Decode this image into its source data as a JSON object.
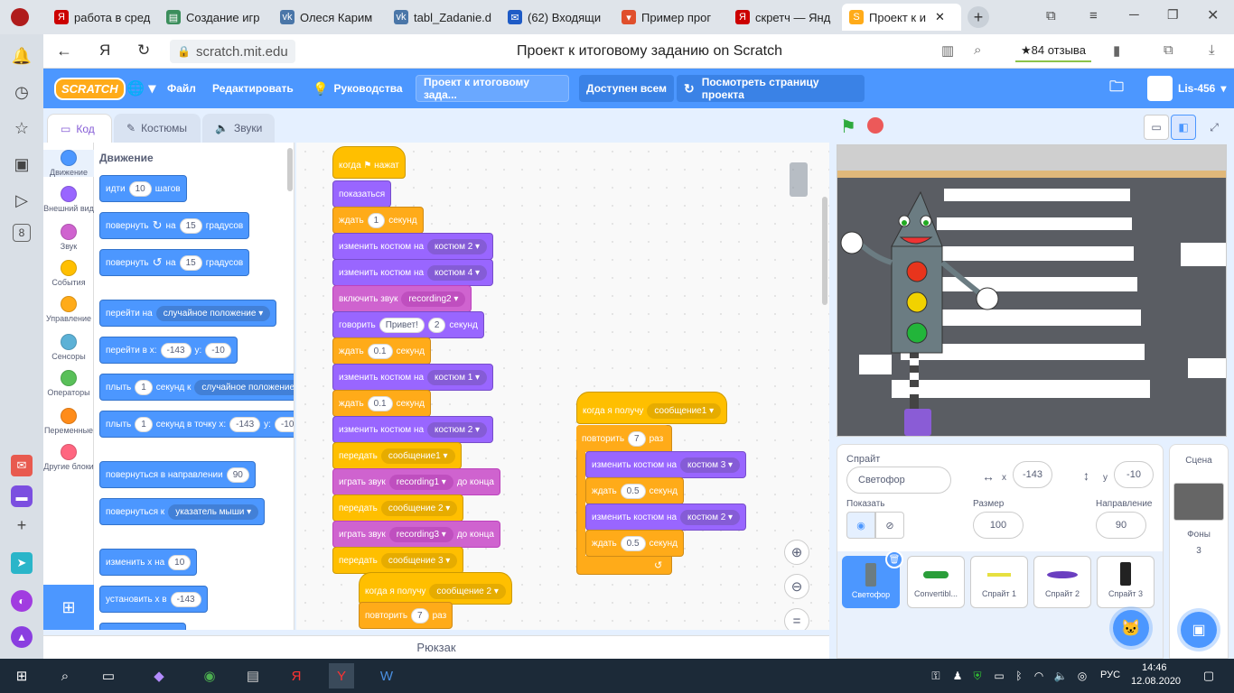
{
  "browser": {
    "tabs": [
      {
        "label": "работа в сред",
        "color": "#cc0000",
        "icon": "Я"
      },
      {
        "label": "Создание игр",
        "color": "#3b8e5c",
        "icon": "▤"
      },
      {
        "label": "Олеся Карим",
        "color": "#4a76a8",
        "icon": "vk"
      },
      {
        "label": "tabl_Zadanie.d",
        "color": "#4a76a8",
        "icon": "vk"
      },
      {
        "label": "(62) Входящи",
        "color": "#1e5bc6",
        "icon": "✉"
      },
      {
        "label": "Пример прог",
        "color": "#e04f2c",
        "icon": "▾"
      },
      {
        "label": "скретч — Янд",
        "color": "#cc0000",
        "icon": "Я"
      },
      {
        "label": "Проект к и",
        "color": "#ffab19",
        "icon": "S"
      }
    ],
    "url": "scratch.mit.edu",
    "page_title": "Проект к итоговому заданию on Scratch",
    "reviews": "★84 отзыва"
  },
  "menu": {
    "logo": "SCRATCH",
    "file": "Файл",
    "edit": "Редактировать",
    "tutorials": "Руководства",
    "project_title": "Проект к итоговому зада...",
    "share": "Доступен всем",
    "see_page": "Посмотреть страницу проекта",
    "user": "Lis-456"
  },
  "editor_tabs": {
    "code": "Код",
    "costumes": "Костюмы",
    "sounds": "Звуки"
  },
  "categories": [
    {
      "label": "Движение",
      "color": "#4c97ff"
    },
    {
      "label": "Внешний вид",
      "color": "#9966ff"
    },
    {
      "label": "Звук",
      "color": "#cf63cf"
    },
    {
      "label": "События",
      "color": "#ffbf00"
    },
    {
      "label": "Управление",
      "color": "#ffab19"
    },
    {
      "label": "Сенсоры",
      "color": "#5cb1d6"
    },
    {
      "label": "Операторы",
      "color": "#59c059"
    },
    {
      "label": "Переменные",
      "color": "#ff8c1a"
    },
    {
      "label": "Другие блоки",
      "color": "#ff6680"
    }
  ],
  "palette": {
    "heading": "Движение",
    "move": {
      "a": "идти",
      "v": "10",
      "b": "шагов"
    },
    "turn_right": {
      "a": "повернуть",
      "b": "на",
      "v": "15",
      "c": "градусов"
    },
    "turn_left": {
      "a": "повернуть",
      "b": "на",
      "v": "15",
      "c": "градусов"
    },
    "goto": {
      "a": "перейти на",
      "d": "случайное положение"
    },
    "gotoxy": {
      "a": "перейти в х:",
      "x": "-143",
      "b": "у:",
      "y": "-10"
    },
    "glide": {
      "a": "плыть",
      "v": "1",
      "b": "секунд к",
      "d": "случайное положение"
    },
    "glidexy": {
      "a": "плыть",
      "v": "1",
      "b": "секунд в точку х:",
      "x": "-143",
      "c": "у:",
      "y": "-10"
    },
    "point_dir": {
      "a": "повернуться в направлении",
      "v": "90"
    },
    "point_to": {
      "a": "повернуться к",
      "d": "указатель мыши"
    },
    "change_x": {
      "a": "изменить х на",
      "v": "10"
    },
    "set_x": {
      "a": "установить х в",
      "v": "-143"
    }
  },
  "script1": {
    "hat": "когда ⚑ нажат",
    "show": "показаться",
    "wait1": {
      "a": "ждать",
      "v": "1",
      "b": "секунд"
    },
    "cost1": {
      "a": "изменить костюм на",
      "d": "костюм 2"
    },
    "cost2": {
      "a": "изменить костюм на",
      "d": "костюм 4"
    },
    "sound": {
      "a": "включить звук",
      "d": "recording2"
    },
    "say": {
      "a": "говорить",
      "v": "Привет!",
      "n": "2",
      "b": "секунд"
    },
    "wait2": {
      "a": "ждать",
      "v": "0.1",
      "b": "секунд"
    },
    "cost3": {
      "a": "изменить костюм на",
      "d": "костюм 1"
    },
    "wait3": {
      "a": "ждать",
      "v": "0.1",
      "b": "секунд"
    },
    "cost4": {
      "a": "изменить костюм на",
      "d": "костюм 2"
    },
    "bc1": {
      "a": "передать",
      "d": "сообщение1"
    },
    "play1": {
      "a": "играть звук",
      "d": "recording1",
      "b": "до конца"
    },
    "bc2": {
      "a": "передать",
      "d": "сообщение 2"
    },
    "play2": {
      "a": "играть звук",
      "d": "recording3",
      "b": "до конца"
    },
    "bc3": {
      "a": "передать",
      "d": "сообщение 3"
    }
  },
  "script2": {
    "hat": {
      "a": "когда я получу",
      "d": "сообщение1"
    },
    "rep": {
      "a": "повторить",
      "v": "7",
      "b": "раз"
    },
    "c1": {
      "a": "изменить костюм на",
      "d": "костюм 3"
    },
    "w1": {
      "a": "ждать",
      "v": "0.5",
      "b": "секунд"
    },
    "c2": {
      "a": "изменить костюм на",
      "d": "костюм 2"
    },
    "w2": {
      "a": "ждать",
      "v": "0.5",
      "b": "секунд"
    }
  },
  "script3": {
    "hat": {
      "a": "когда я получу",
      "d": "сообщение 2"
    },
    "rep": {
      "a": "повторить",
      "v": "7",
      "b": "раз"
    }
  },
  "backpack": "Рюкзак",
  "sprite": {
    "label": "Спрайт",
    "name": "Светофор",
    "x_label": "x",
    "x": "-143",
    "y_label": "y",
    "y": "-10",
    "show_label": "Показать",
    "size_label": "Размер",
    "size": "100",
    "dir_label": "Направление",
    "dir": "90"
  },
  "sprites": [
    "Светофор",
    "Convertibl...",
    "Спрайт 1",
    "Спрайт 2",
    "Спрайт 3"
  ],
  "scene": {
    "label": "Сцена",
    "backdrops_label": "Фоны",
    "backdrops": "3"
  },
  "taskbar": {
    "lang": "РУС",
    "time": "14:46",
    "date": "12.08.2020"
  }
}
